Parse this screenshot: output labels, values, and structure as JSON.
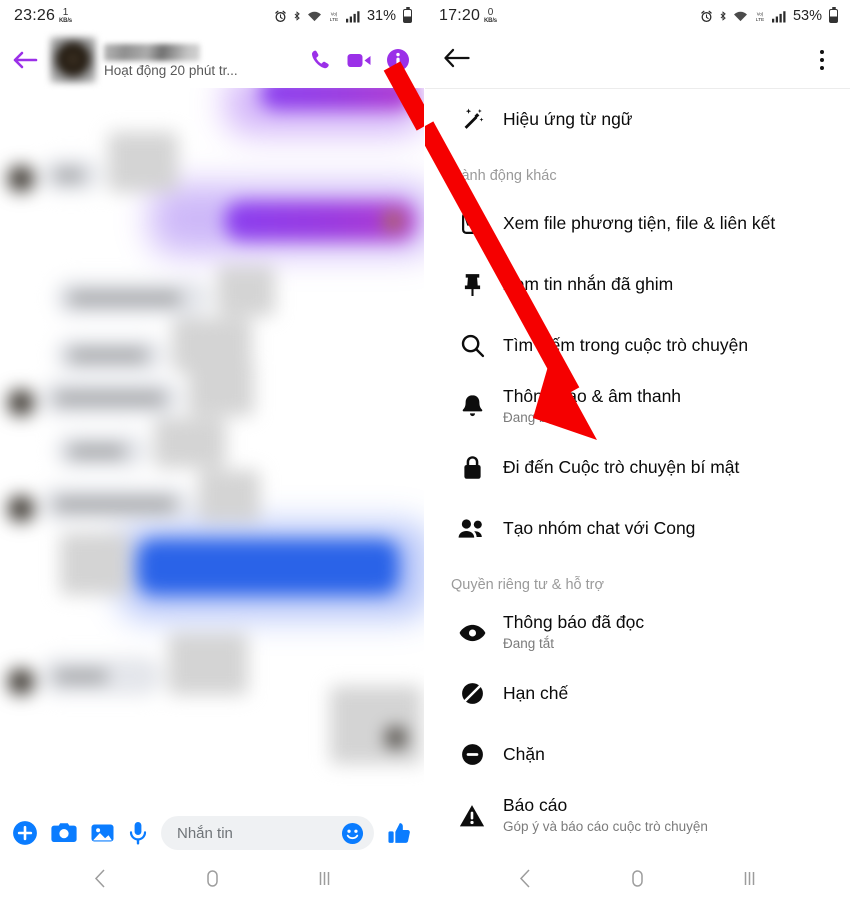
{
  "left_panel": {
    "status_bar": {
      "time": "23:26",
      "net_rate": "1",
      "net_unit": "KB/s",
      "battery": "31%",
      "icons": [
        "alarm-icon",
        "bluetooth-icon",
        "wifi-icon",
        "volte-icon",
        "signal-icon",
        "battery-icon"
      ]
    },
    "chat_header": {
      "back": "back-arrow",
      "contact_name_hidden": "",
      "status": "Hoạt động 20 phút tr...",
      "actions": [
        "phone-icon",
        "video-icon",
        "info-icon"
      ],
      "accent": "#9b30e8"
    },
    "composer": {
      "placeholder": "Nhắn tin",
      "value": "",
      "accent": "#0a7cff",
      "icons": [
        "plus-icon",
        "camera-icon",
        "gallery-icon",
        "microphone-icon",
        "emoji-icon",
        "thumbs-up-icon"
      ]
    },
    "nav_bar": {
      "items": [
        "back-nav-icon",
        "home-nav-icon",
        "recents-nav-icon"
      ]
    }
  },
  "right_panel": {
    "status_bar": {
      "time": "17:20",
      "net_rate": "0",
      "net_unit": "KB/s",
      "battery": "53%",
      "icons": [
        "alarm-icon",
        "bluetooth-icon",
        "wifi-icon",
        "volte-icon",
        "signal-icon",
        "battery-icon"
      ]
    },
    "menu_header": {
      "back": "back-arrow",
      "overflow": "kebab-menu-icon"
    },
    "top_item": {
      "label": "Hiệu ứng từ ngữ",
      "icon": "magic-wand-icon"
    },
    "sections": [
      {
        "title": "Hành động khác",
        "items": [
          {
            "label": "Xem file phương tiện, file & liên kết",
            "sub": "",
            "icon": "media-files-icon"
          },
          {
            "label": "Xem tin nhắn đã ghim",
            "sub": "",
            "icon": "pin-icon"
          },
          {
            "label": "Tìm kiếm trong cuộc trò chuyện",
            "sub": "",
            "icon": "search-icon"
          },
          {
            "label": "Thông báo & âm thanh",
            "sub": "Đang bật",
            "icon": "bell-icon"
          },
          {
            "label": "Đi đến Cuộc trò chuyện bí mật",
            "sub": "",
            "icon": "lock-icon"
          },
          {
            "label": "Tạo nhóm chat với Cong",
            "sub": "",
            "icon": "people-icon"
          }
        ]
      },
      {
        "title": "Quyền riêng tư & hỗ trợ",
        "items": [
          {
            "label": "Thông báo đã đọc",
            "sub": "Đang tắt",
            "icon": "eye-icon"
          },
          {
            "label": "Hạn chế",
            "sub": "",
            "icon": "restrict-icon"
          },
          {
            "label": "Chặn",
            "sub": "",
            "icon": "block-icon"
          },
          {
            "label": "Báo cáo",
            "sub": "Góp ý và báo cáo cuộc trò chuyện",
            "icon": "warning-icon"
          }
        ]
      }
    ],
    "nav_bar": {
      "items": [
        "back-nav-icon",
        "home-nav-icon",
        "recents-nav-icon"
      ]
    }
  },
  "annotation": {
    "type": "arrow",
    "color": "#f50000",
    "from": "info-icon",
    "to": "Đi đến Cuộc trò chuyện bí mật"
  }
}
